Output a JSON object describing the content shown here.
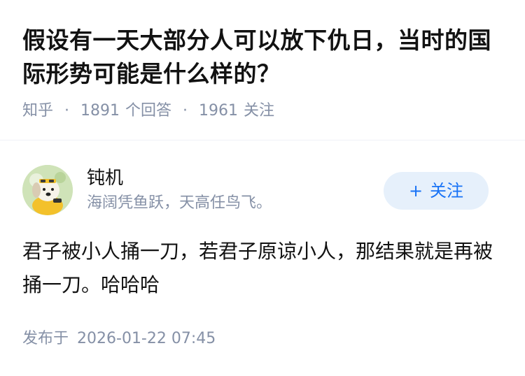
{
  "question": {
    "title": "假设有一天大部分人可以放下仇日，当时的国际形势可能是什么样的？",
    "source": "知乎",
    "separator": "·",
    "answer_count": "1891",
    "answer_label": "个回答",
    "follower_count": "1961",
    "follower_label": "关注"
  },
  "author": {
    "name": "钝机",
    "bio": "海阔凭鱼跃，天高任鸟飞。",
    "avatar_icon": "cartoon-dog-avatar"
  },
  "follow_button": {
    "plus": "+",
    "label": "关注",
    "bg_color": "#e6f0fb",
    "text_color": "#1772f6"
  },
  "answer": {
    "content": "君子被小人捅一刀，若君子原谅小人，那结果就是再被捅一刀。哈哈哈",
    "publish_label": "发布于",
    "publish_time": "2026-01-22 07:45"
  }
}
